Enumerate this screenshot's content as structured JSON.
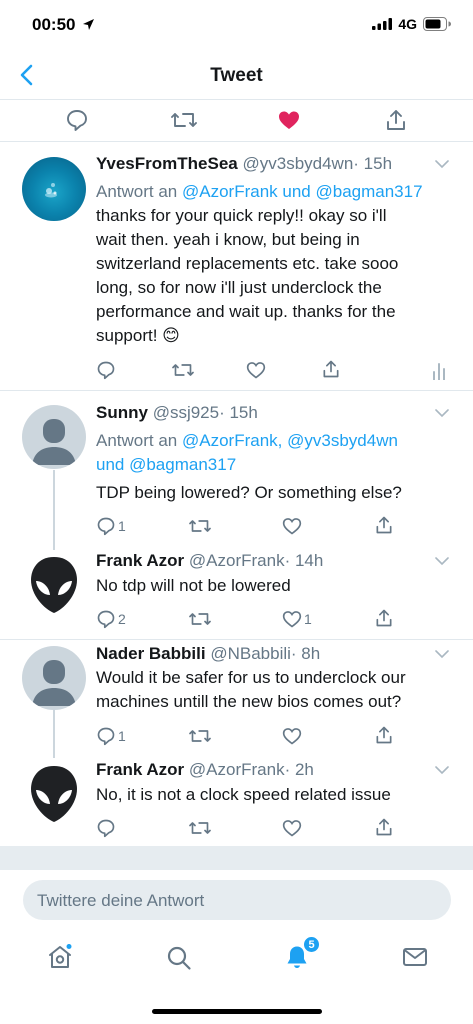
{
  "status": {
    "time": "00:50",
    "network": "4G"
  },
  "header": {
    "title": "Tweet"
  },
  "colors": {
    "accent": "#1da1f2",
    "like": "#e0245e",
    "text": "#14171a",
    "secondary": "#657786",
    "divider": "#e1e8ed"
  },
  "tweets": [
    {
      "name": "YvesFromTheSea",
      "handle": "@yv3sbyd4wn",
      "time": "· 15h",
      "reply_prefix": "Antwort an ",
      "reply_mentions": "@AzorFrank und @bagman317",
      "reply_mentions_line2": "",
      "text_lines": [
        "thanks for your quick reply!! okay so i'll",
        "wait then. yeah i know, but being in",
        "switzerland replacements etc. take sooo",
        "long, so for now i'll just underclock the",
        "performance and wait up. thanks for the",
        "support! 😊"
      ],
      "reply_count": "",
      "like_count": ""
    },
    {
      "name": "Sunny",
      "handle": "@ssj925",
      "time": "· 15h",
      "reply_prefix": "Antwort an ",
      "reply_mentions": "@AzorFrank, @yv3sbyd4wn",
      "reply_mentions_line2": "und @bagman317",
      "text_lines": [
        "TDP being lowered? Or something else?"
      ],
      "reply_count": "1",
      "like_count": ""
    },
    {
      "name": "Frank Azor",
      "handle": "@AzorFrank",
      "time": "· 14h",
      "text_lines": [
        "No tdp will not be lowered"
      ],
      "reply_count": "2",
      "like_count": "1"
    },
    {
      "name": "Nader Babbili",
      "handle": "@NBabbili",
      "time": "· 8h",
      "text_lines": [
        "Would it be safer for us to underclock our",
        "machines untill the new bios comes out?"
      ],
      "reply_count": "1",
      "like_count": ""
    },
    {
      "name": "Frank Azor",
      "handle": "@AzorFrank",
      "time": "· 2h",
      "text_lines": [
        "No, it is not a clock speed related issue"
      ],
      "reply_count": "",
      "like_count": ""
    }
  ],
  "compose": {
    "placeholder": "Twittere deine Antwort"
  },
  "tabbar": {
    "notification_badge": "5"
  },
  "icons": [
    "back-chevron-icon",
    "comment-icon",
    "retweet-icon",
    "heart-icon",
    "share-icon",
    "analytics-icon",
    "home-icon",
    "search-icon",
    "bell-icon",
    "mail-icon",
    "alien-avatar",
    "default-avatar"
  ]
}
